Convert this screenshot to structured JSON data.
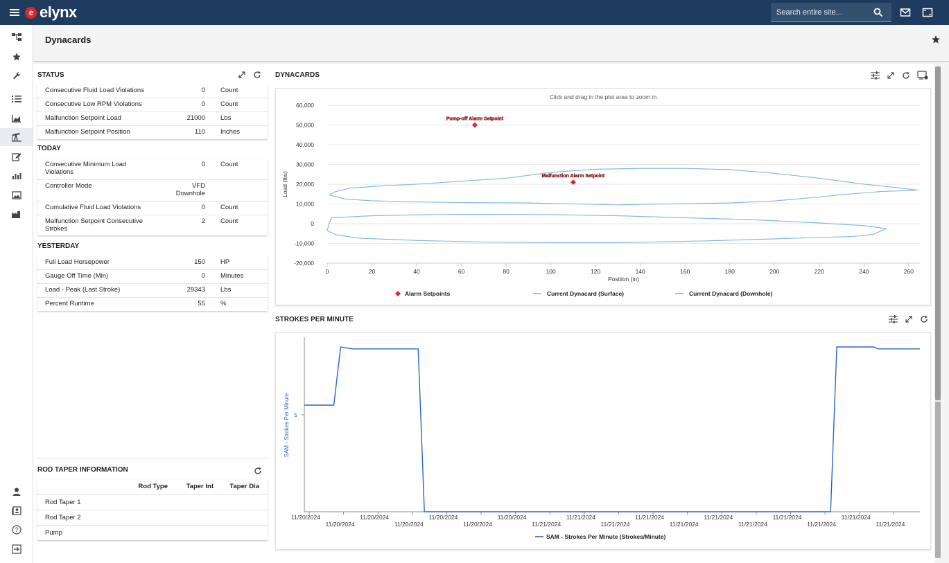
{
  "header": {
    "logo_text": "elynx",
    "logo_mark": "e",
    "search_placeholder": "Search entire site..."
  },
  "page": {
    "title": "Dynacards"
  },
  "status": {
    "title": "STATUS",
    "rows": [
      {
        "label": "Consecutive Fluid Load Violations",
        "value": "0",
        "unit": "Count"
      },
      {
        "label": "Consecutive Low RPM Violations",
        "value": "0",
        "unit": "Count"
      },
      {
        "label": "Malfunction Setpoint Load",
        "value": "21000",
        "unit": "Lbs"
      },
      {
        "label": "Malfunction Setpoint Position",
        "value": "110",
        "unit": "Inches"
      }
    ]
  },
  "today": {
    "title": "TODAY",
    "rows": [
      {
        "label": "Consecutive Minimum Load Violations",
        "value": "0",
        "unit": "Count"
      },
      {
        "label": "Controller Mode",
        "value": "VFD Downhole",
        "unit": ""
      },
      {
        "label": "Cumulative Fluid Load Violations",
        "value": "0",
        "unit": "Count"
      },
      {
        "label": "Malfunction Setpoint Consecutive Strokes",
        "value": "2",
        "unit": "Count"
      }
    ]
  },
  "yesterday": {
    "title": "YESTERDAY",
    "rows": [
      {
        "label": "Full Load Horsepower",
        "value": "150",
        "unit": "HP"
      },
      {
        "label": "Gauge Off Time (Min)",
        "value": "0",
        "unit": "Minutes"
      },
      {
        "label": "Load - Peak (Last Stroke)",
        "value": "29343",
        "unit": "Lbs"
      },
      {
        "label": "Percent Runtime",
        "value": "55",
        "unit": "%"
      }
    ]
  },
  "rod_taper": {
    "title": "ROD TAPER INFORMATION",
    "columns": [
      "Rod Type",
      "Taper Int",
      "Taper Dia"
    ],
    "rows": [
      "Rod Taper 1",
      "Rod Taper 2",
      "Pump"
    ]
  },
  "dynacards": {
    "title": "DYNACARDS"
  },
  "spm": {
    "title": "STROKES PER MINUTE"
  },
  "chart_data": [
    {
      "type": "line",
      "hint": "Click and drag in the plot area to zoom in",
      "xlabel": "Position (in)",
      "ylabel": "Load (lbs)",
      "xlim": [
        0,
        265
      ],
      "ylim": [
        -20000,
        60000
      ],
      "x_ticks": [
        0,
        20,
        40,
        60,
        80,
        100,
        120,
        140,
        160,
        180,
        200,
        220,
        240,
        260
      ],
      "y_ticks": [
        60000,
        50000,
        40000,
        30000,
        20000,
        10000,
        0,
        -10000,
        -20000
      ],
      "x_tick_labels": [
        "0",
        "20",
        "40",
        "60",
        "80",
        "100",
        "120",
        "140",
        "160",
        "180",
        "200",
        "220",
        "240",
        "260"
      ],
      "y_tick_labels": [
        "60,000",
        "50,000",
        "40,000",
        "30,000",
        "20,000",
        "10,000",
        "0",
        "-10,000",
        "-20,000"
      ],
      "series": [
        {
          "name": "Alarm Setpoints",
          "kind": "scatter",
          "color": "#e0262c",
          "points": [
            {
              "x": 66,
              "y": 50000,
              "label": "Pump-off Alarm Setpoint"
            },
            {
              "x": 110,
              "y": 21000,
              "label": "Malfunction Alarm Setpoint"
            }
          ]
        },
        {
          "name": "Current Dynacard (Surface)",
          "kind": "line",
          "color": "#7fb3e3",
          "points": [
            [
              3,
              16000
            ],
            [
              10,
              18000
            ],
            [
              25,
              19200
            ],
            [
              40,
              20000
            ],
            [
              60,
              21500
            ],
            [
              80,
              23000
            ],
            [
              100,
              26000
            ],
            [
              120,
              27600
            ],
            [
              140,
              28000
            ],
            [
              160,
              28000
            ],
            [
              180,
              27400
            ],
            [
              200,
              25500
            ],
            [
              220,
              23000
            ],
            [
              240,
              20000
            ],
            [
              255,
              18200
            ],
            [
              264,
              17000
            ],
            [
              255,
              16600
            ],
            [
              248,
              16300
            ],
            [
              240,
              15600
            ],
            [
              230,
              14700
            ],
            [
              220,
              13500
            ],
            [
              200,
              11500
            ],
            [
              180,
              10500
            ],
            [
              160,
              10100
            ],
            [
              140,
              9800
            ],
            [
              130,
              9500
            ],
            [
              110,
              10000
            ],
            [
              90,
              10500
            ],
            [
              60,
              10700
            ],
            [
              40,
              11000
            ],
            [
              20,
              11600
            ],
            [
              8,
              12500
            ],
            [
              1,
              14500
            ],
            [
              3,
              16000
            ]
          ]
        },
        {
          "name": "Current Dynacard (Downhole)",
          "kind": "line",
          "color": "#7fb3e3",
          "points": [
            [
              2,
              3000
            ],
            [
              20,
              4000
            ],
            [
              40,
              4500
            ],
            [
              60,
              4700
            ],
            [
              80,
              4700
            ],
            [
              100,
              4600
            ],
            [
              130,
              4000
            ],
            [
              160,
              3000
            ],
            [
              190,
              2000
            ],
            [
              220,
              400
            ],
            [
              240,
              -1000
            ],
            [
              250,
              -2500
            ],
            [
              244,
              -5500
            ],
            [
              235,
              -6500
            ],
            [
              200,
              -7700
            ],
            [
              170,
              -8700
            ],
            [
              130,
              -9600
            ],
            [
              100,
              -9600
            ],
            [
              70,
              -9300
            ],
            [
              40,
              -8500
            ],
            [
              15,
              -7400
            ],
            [
              4,
              -5700
            ],
            [
              0,
              -3500
            ],
            [
              1,
              500
            ],
            [
              2,
              3000
            ]
          ]
        }
      ],
      "legend_position": "bottom"
    },
    {
      "type": "line",
      "ylabel": "SAM - Strokes Per Minute",
      "y_ticks": [
        5
      ],
      "y_tick_labels": [
        "5"
      ],
      "ylim": [
        0,
        9
      ],
      "xlim": [
        0,
        100
      ],
      "x_tick_labels_row1": [
        "11/20/2024",
        "11/20/2024",
        "11/20/2024",
        "11/20/2024",
        "11/21/2024",
        "11/21/2024",
        "11/21/2024",
        "11/21/2024",
        "11/21/2024"
      ],
      "x_tick_labels_row2": [
        "11/20/2024",
        "11/20/2024",
        "11/20/2024",
        "11/21/2024",
        "11/21/2024",
        "11/21/2024",
        "11/21/2024",
        "11/21/2024",
        "11/21/2024"
      ],
      "series": [
        {
          "name": "SAM - Strokes Per Minute (Strokes/Minute)",
          "color": "#2f63c4",
          "points": [
            [
              0,
              5.5
            ],
            [
              4.8,
              5.5
            ],
            [
              5.9,
              8.5
            ],
            [
              7.8,
              8.4
            ],
            [
              18.5,
              8.4
            ],
            [
              19.5,
              0
            ],
            [
              85.5,
              0
            ],
            [
              86.5,
              8.5
            ],
            [
              92.5,
              8.5
            ],
            [
              93.2,
              8.4
            ],
            [
              100,
              8.4
            ]
          ]
        }
      ],
      "legend_position": "bottom"
    }
  ]
}
